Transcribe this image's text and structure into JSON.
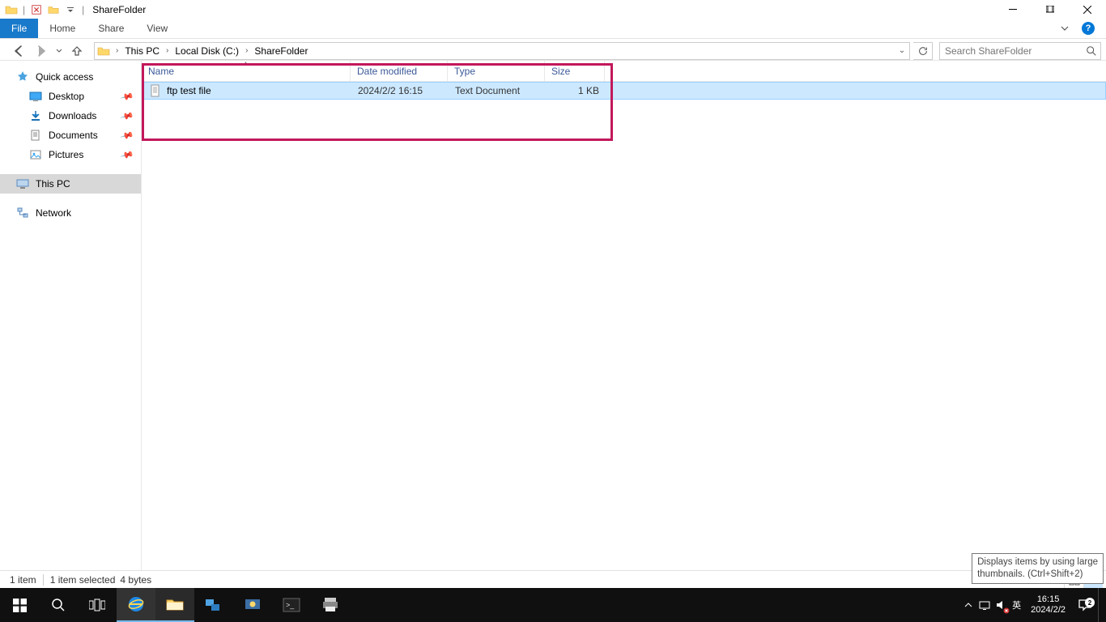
{
  "window": {
    "title": "ShareFolder"
  },
  "ribbon": {
    "file": "File",
    "tabs": [
      "Home",
      "Share",
      "View"
    ]
  },
  "breadcrumb": {
    "items": [
      "This PC",
      "Local Disk (C:)",
      "ShareFolder"
    ]
  },
  "search": {
    "placeholder": "Search ShareFolder"
  },
  "navpane": {
    "quick_access": "Quick access",
    "items": [
      {
        "label": "Desktop",
        "pinned": true,
        "icon": "desktop"
      },
      {
        "label": "Downloads",
        "pinned": true,
        "icon": "downloads"
      },
      {
        "label": "Documents",
        "pinned": true,
        "icon": "documents"
      },
      {
        "label": "Pictures",
        "pinned": true,
        "icon": "pictures"
      }
    ],
    "this_pc": "This PC",
    "network": "Network"
  },
  "columns": {
    "name": "Name",
    "date": "Date modified",
    "type": "Type",
    "size": "Size"
  },
  "files": [
    {
      "name": "ftp test file",
      "date": "2024/2/2 16:15",
      "type": "Text Document",
      "size": "1 KB"
    }
  ],
  "statusbar": {
    "count": "1 item",
    "selection": "1 item selected",
    "bytes": "4 bytes"
  },
  "tooltip": {
    "line1": "Displays items by using large",
    "line2": "thumbnails.  (Ctrl+Shift+2)"
  },
  "tray": {
    "ime": "英",
    "time": "16:15",
    "date": "2024/2/2",
    "notifications": "2"
  }
}
